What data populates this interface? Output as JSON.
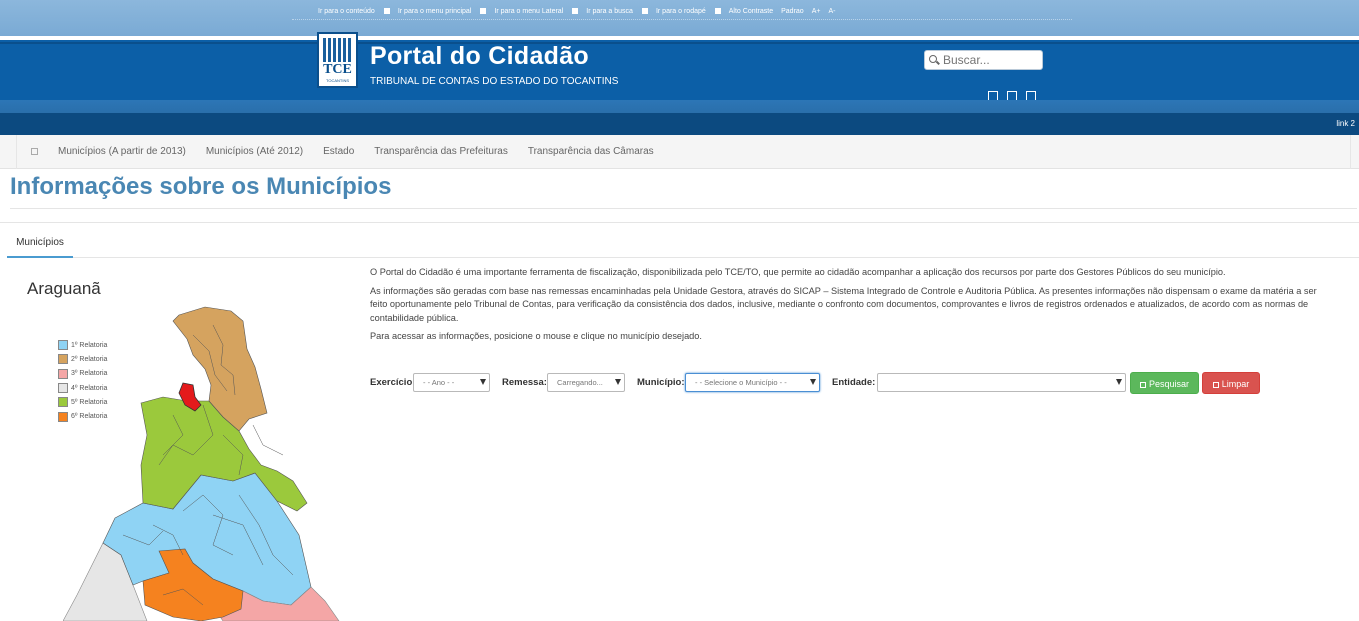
{
  "accessibility": {
    "links": [
      "Ir para o conteúdo",
      "Ir para o menu principal",
      "Ir para o menu Lateral",
      "Ir para a busca",
      "Ir para o rodapé"
    ],
    "contrast": "Alto Contraste",
    "default": "Padrao",
    "font_up": "A+",
    "font_down": "A-"
  },
  "header": {
    "logo_text": "TCE",
    "logo_sub": "TOCANTINS",
    "title": "Portal do Cidadão",
    "subtitle": "TRIBUNAL DE CONTAS DO ESTADO DO TOCANTINS",
    "search_placeholder": "Buscar..."
  },
  "band": {
    "link": "link 2"
  },
  "nav": {
    "items": [
      "Municípios (A partir de 2013)",
      "Municípios (Até 2012)",
      "Estado",
      "Transparência das Prefeituras",
      "Transparência das Câmaras"
    ]
  },
  "page": {
    "title": "Informações sobre os Municípios",
    "tab": "Municípios"
  },
  "map": {
    "selected": "Araguanã",
    "legend": [
      {
        "label": "1º Relatoria",
        "color": "#8fd3f4"
      },
      {
        "label": "2º Relatoria",
        "color": "#d5a35f"
      },
      {
        "label": "3º Relatoria",
        "color": "#f4a6a6"
      },
      {
        "label": "4º Relatoria",
        "color": "#e6e6e6"
      },
      {
        "label": "5º Relatoria",
        "color": "#9bc93c"
      },
      {
        "label": "6º Relatoria",
        "color": "#f5821f"
      }
    ]
  },
  "content": {
    "p1": "O Portal do Cidadão é uma importante ferramenta de fiscalização, disponibilizada pelo TCE/TO, que permite ao cidadão acompanhar a aplicação dos recursos por parte dos Gestores Públicos do seu município.",
    "p2": "As informações são geradas com base nas remessas encaminhadas pela Unidade Gestora, através do SICAP – Sistema Integrado de Controle e Auditoria Pública. As presentes informações não dispensam o exame da matéria a ser feito oportunamente pelo Tribunal de Contas, para verificação da consistência dos dados, inclusive, mediante o confronto com documentos, comprovantes e livros de registros ordenados e atualizados, de acordo com as normas de contabilidade pública.",
    "p3": "Para acessar as informações, posicione o mouse e clique no município desejado."
  },
  "filters": {
    "exercicio_label": "Exercício:",
    "exercicio_value": "- - Ano - -",
    "remessa_label": "Remessa:",
    "remessa_value": "Carregando...",
    "municipio_label": "Município:",
    "municipio_value": "- - Selecione o Município - -",
    "entidade_label": "Entidade:",
    "entidade_value": "",
    "search_button": "Pesquisar",
    "clear_button": "Limpar"
  }
}
